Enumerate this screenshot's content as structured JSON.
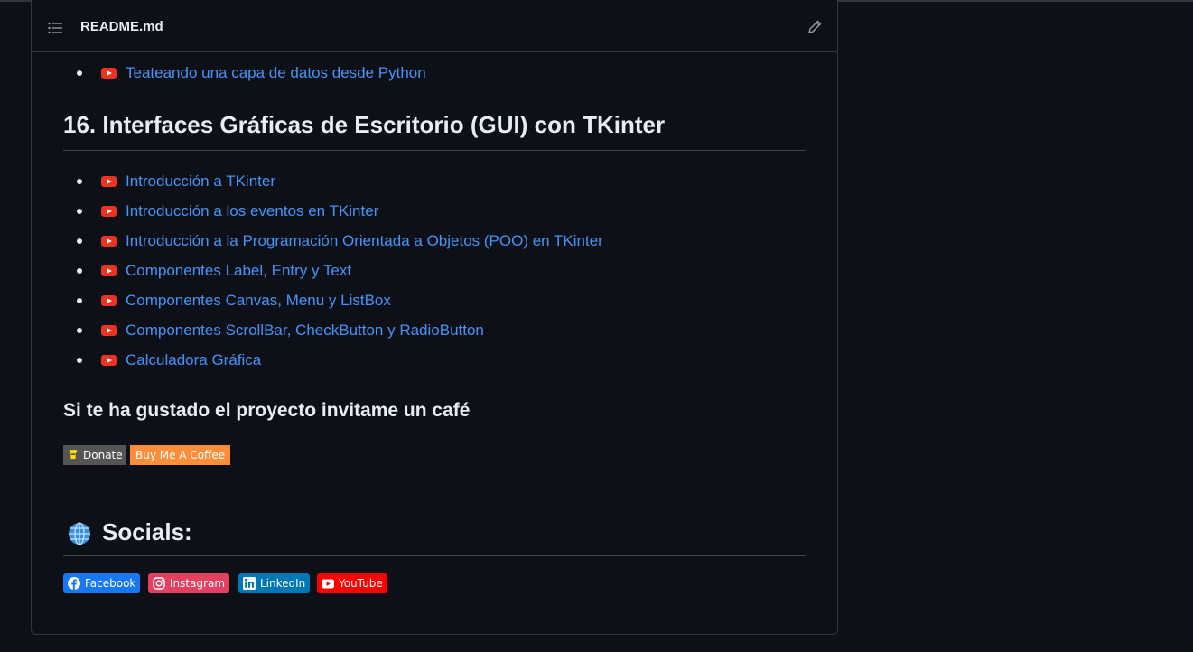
{
  "readme": {
    "title": "README.md"
  },
  "prev_section": {
    "items": [
      {
        "label": "Teateando una capa de datos desde Python"
      }
    ]
  },
  "section16": {
    "heading": "16. Interfaces Gráficas de Escritorio (GUI) con TKinter",
    "items": [
      {
        "label": "Introducción a TKinter"
      },
      {
        "label": "Introducción a los eventos en TKinter"
      },
      {
        "label": "Introducción a la Programación Orientada a Objetos (POO) en TKinter"
      },
      {
        "label": "Componentes Label, Entry y Text"
      },
      {
        "label": "Componentes Canvas, Menu y ListBox"
      },
      {
        "label": "Componentes ScrollBar, CheckButton y RadioButton"
      },
      {
        "label": "Calculadora Gráfica"
      }
    ]
  },
  "coffee": {
    "heading": "Si te ha gustado el proyecto invitame un café",
    "badge_left": "Donate",
    "badge_right": "Buy Me A Coffee"
  },
  "socials": {
    "heading": "Socials:",
    "badges": [
      {
        "label": "Facebook",
        "color": "#1877F2",
        "icon": "facebook-icon"
      },
      {
        "label": "Instagram",
        "color": "#E4405F",
        "icon": "instagram-icon"
      },
      {
        "label": "LinkedIn",
        "color": "#0077B5",
        "icon": "linkedin-icon"
      },
      {
        "label": "YouTube",
        "color": "#FF0000",
        "icon": "youtube-icon"
      }
    ]
  },
  "colors": {
    "link": "#4493f8",
    "background": "#0d1117",
    "border": "#30363d",
    "youtube_red": "#ea3323"
  }
}
